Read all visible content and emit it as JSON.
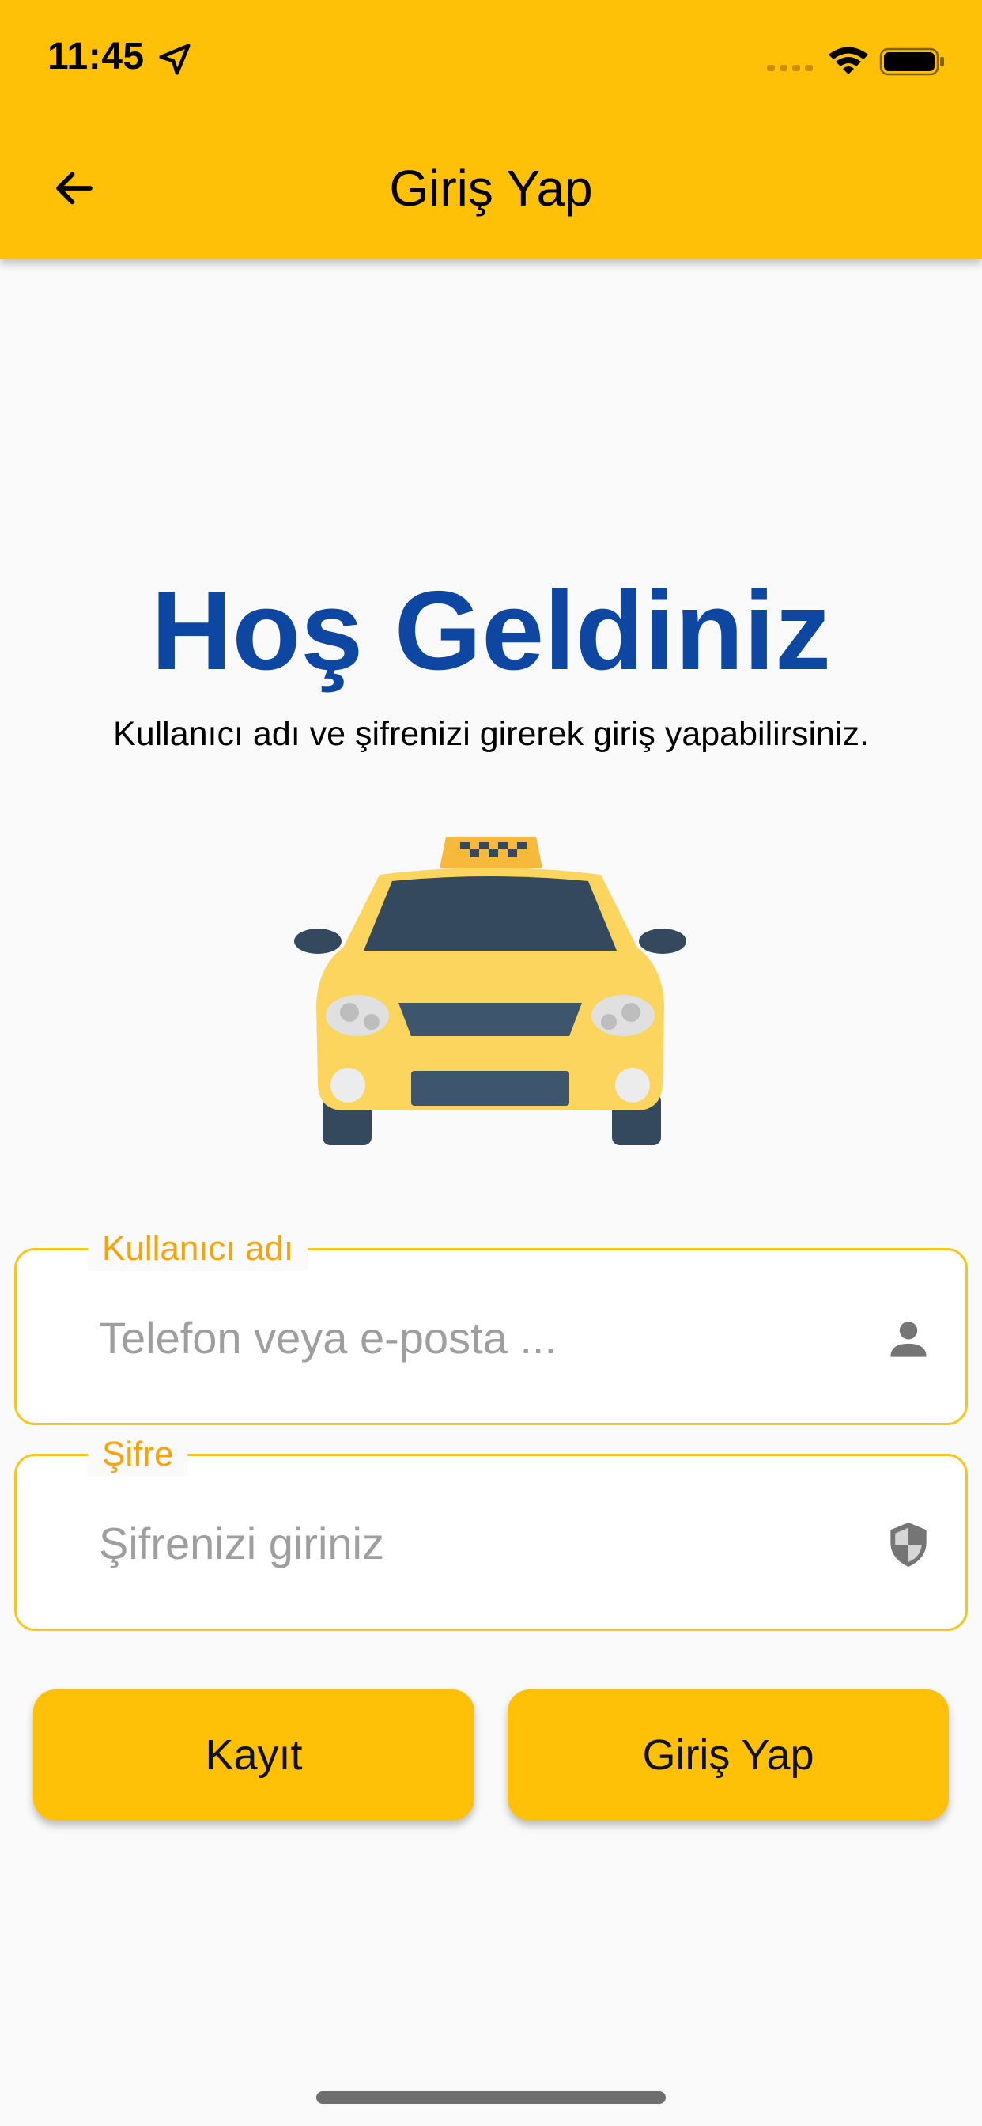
{
  "status_bar": {
    "time": "11:45",
    "icons": [
      "location-arrow-icon",
      "signal-dots-icon",
      "wifi-icon",
      "battery-icon"
    ]
  },
  "app_bar": {
    "title": "Giriş Yap",
    "back_icon": "arrow-left-icon"
  },
  "welcome": {
    "title": "Hoş Geldiniz",
    "subtitle": "Kullanıcı adı ve şifrenizi girerek giriş yapabilirsiniz."
  },
  "illustration": {
    "icon": "taxi-illustration"
  },
  "form": {
    "username": {
      "label": "Kullanıcı adı",
      "placeholder": "Telefon veya e-posta ...",
      "value": "",
      "icon": "person-icon"
    },
    "password": {
      "label": "Şifre",
      "placeholder": "Şifrenizi giriniz",
      "value": "",
      "icon": "shield-icon"
    }
  },
  "buttons": {
    "register_label": "Kayıt",
    "login_label": "Giriş Yap"
  },
  "colors": {
    "primary": "#fec107",
    "title_blue": "#0d47a1",
    "field_border": "#f9c51c",
    "field_label": "#f9a209",
    "background": "#fafafa"
  }
}
